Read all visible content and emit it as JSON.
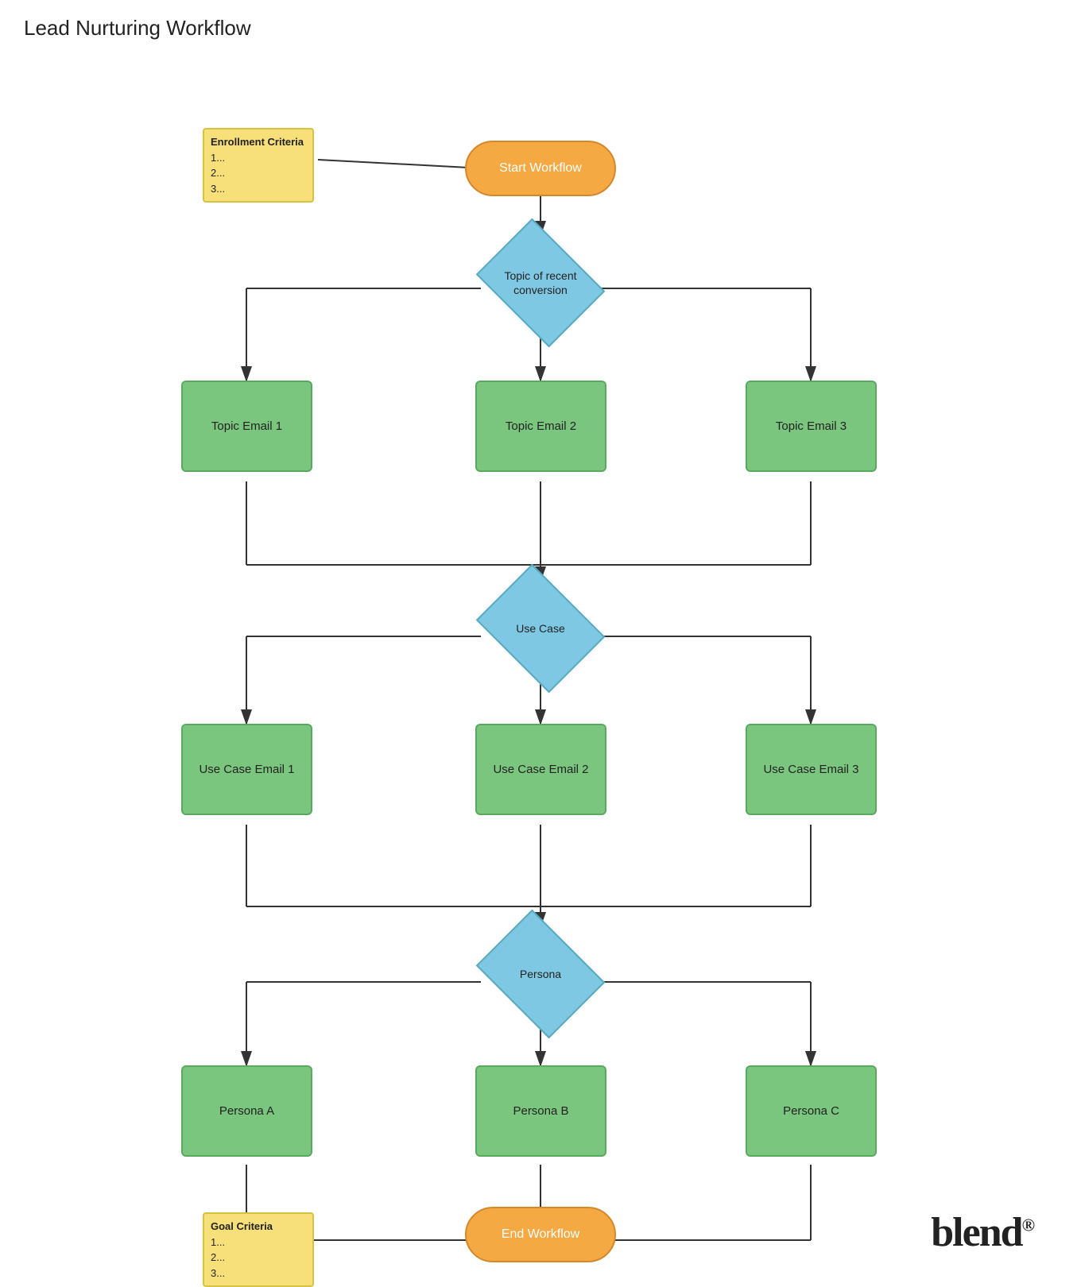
{
  "title": "Lead Nurturing Workflow",
  "nodes": {
    "start": {
      "label": "Start Workflow"
    },
    "end": {
      "label": "End Workflow"
    },
    "topic_decision": {
      "label": "Topic of recent conversion"
    },
    "usecase_decision": {
      "label": "Use Case"
    },
    "persona_decision": {
      "label": "Persona"
    },
    "topic_email_1": {
      "label": "Topic Email 1"
    },
    "topic_email_2": {
      "label": "Topic Email 2"
    },
    "topic_email_3": {
      "label": "Topic Email 3"
    },
    "usecase_email_1": {
      "label": "Use Case Email 1"
    },
    "usecase_email_2": {
      "label": "Use Case Email 2"
    },
    "usecase_email_3": {
      "label": "Use Case Email 3"
    },
    "persona_a": {
      "label": "Persona A"
    },
    "persona_b": {
      "label": "Persona B"
    },
    "persona_c": {
      "label": "Persona C"
    },
    "enrollment": {
      "title": "Enrollment Criteria",
      "lines": [
        "1...",
        "2...",
        "3..."
      ]
    },
    "goal": {
      "title": "Goal Criteria",
      "lines": [
        "1...",
        "2...",
        "3..."
      ]
    }
  },
  "blend_logo": "blend",
  "blend_reg": "®"
}
